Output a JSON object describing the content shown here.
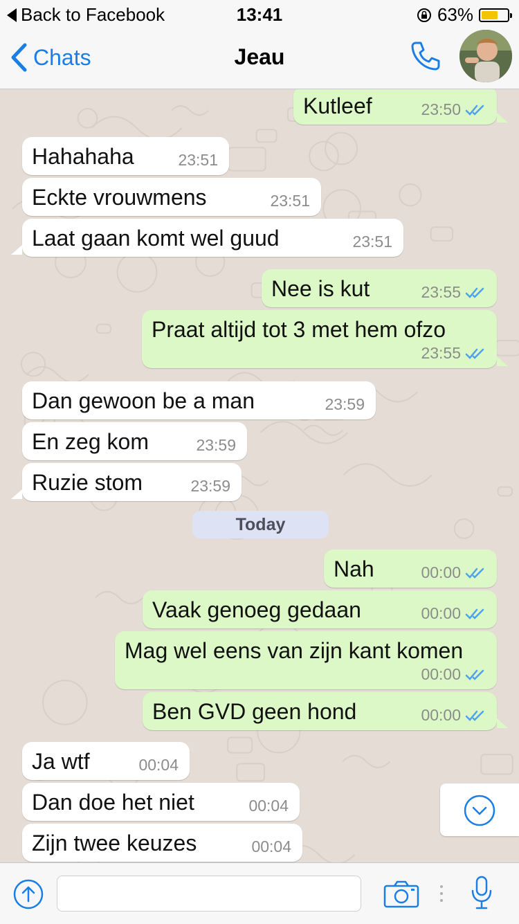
{
  "status_bar": {
    "back_app": "Back to Facebook",
    "time": "13:41",
    "battery": "63%",
    "battery_level": 0.63
  },
  "nav": {
    "back_label": "Chats",
    "title": "Jeau",
    "call_icon": "phone-icon",
    "avatar_icon": "contact-avatar"
  },
  "messages": [
    {
      "dir": "out",
      "text": "Kutleef",
      "time": "23:50",
      "ticks": "double-blue"
    },
    {
      "dir": "in",
      "text": "Hahahaha",
      "time": "23:51"
    },
    {
      "dir": "in",
      "text": "Eckte vrouwmens",
      "time": "23:51"
    },
    {
      "dir": "in",
      "text": "Laat gaan komt wel guud",
      "time": "23:51"
    },
    {
      "dir": "out",
      "text": "Nee is kut",
      "time": "23:55",
      "ticks": "double-blue"
    },
    {
      "dir": "out",
      "text": "Praat altijd tot 3 met hem ofzo",
      "time": "23:55",
      "ticks": "double-blue"
    },
    {
      "dir": "in",
      "text": "Dan gewoon be a man",
      "time": "23:59"
    },
    {
      "dir": "in",
      "text": "En zeg kom",
      "time": "23:59"
    },
    {
      "dir": "in",
      "text": "Ruzie stom",
      "time": "23:59"
    },
    {
      "dir": "out",
      "text": "Nah",
      "time": "00:00",
      "ticks": "double-blue"
    },
    {
      "dir": "out",
      "text": "Vaak genoeg gedaan",
      "time": "00:00",
      "ticks": "double-blue"
    },
    {
      "dir": "out",
      "text": "Mag wel eens van zijn kant komen",
      "time": "00:00",
      "ticks": "double-blue"
    },
    {
      "dir": "out",
      "text": "Ben GVD geen hond",
      "time": "00:00",
      "ticks": "double-blue"
    },
    {
      "dir": "in",
      "text": "Ja wtf",
      "time": "00:04"
    },
    {
      "dir": "in",
      "text": "Dan doe het niet",
      "time": "00:04"
    },
    {
      "dir": "in",
      "text": "Zijn twee keuzes",
      "time": "00:04"
    }
  ],
  "date_divider": "Today",
  "input_bar": {
    "value": "",
    "placeholder": "",
    "icons": [
      "upload-icon",
      "camera-icon",
      "more-dots-icon",
      "microphone-icon"
    ]
  },
  "colors": {
    "accent": "#1a7ee6",
    "outgoing_bubble": "#dcf8c6",
    "incoming_bubble": "#ffffff",
    "chat_background": "#e5ddd5",
    "read_ticks": "#4fa3e8"
  }
}
